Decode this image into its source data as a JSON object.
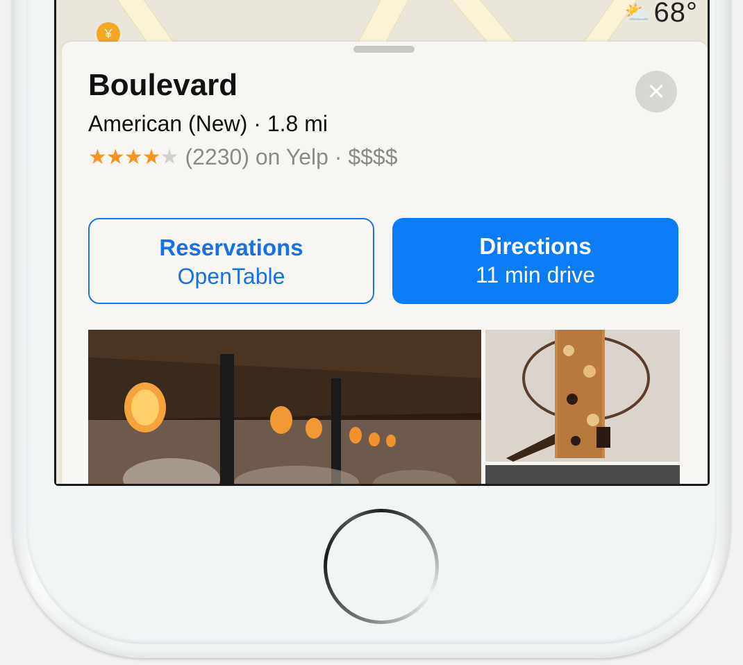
{
  "weather": {
    "temperature": "68°",
    "icon": "partly-sunny-icon"
  },
  "place": {
    "name": "Boulevard",
    "category_distance": "American (New) · 1.8 mi",
    "stars": "★★★★",
    "half_star": "★",
    "rating_value": 4.5,
    "reviews_text": "(2230) on Yelp · $$$$"
  },
  "actions": {
    "reservations_title": "Reservations",
    "reservations_sub": "OpenTable",
    "directions_title": "Directions",
    "directions_sub": "11 min drive"
  },
  "colors": {
    "accent": "#0a7cf5",
    "star": "#f7931e"
  }
}
